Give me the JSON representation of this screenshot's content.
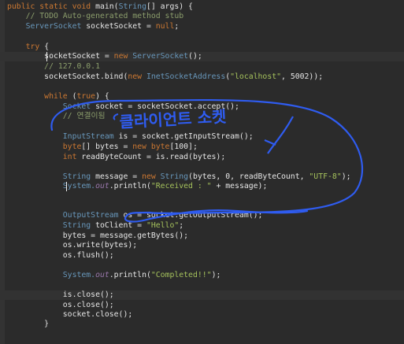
{
  "editor": {
    "lines": [
      {
        "t": 3,
        "parts": [
          {
            "s": "public static void ",
            "c": "kw"
          },
          {
            "s": "main(",
            "c": ""
          },
          {
            "s": "String",
            "c": "ty"
          },
          {
            "s": "[] args) {",
            "c": ""
          }
        ]
      },
      {
        "t": 15,
        "parts": [
          {
            "s": "    // TODO Auto-generated method stub",
            "c": "cm"
          }
        ]
      },
      {
        "t": 28,
        "parts": [
          {
            "s": "    ServerSocket",
            "c": "ty"
          },
          {
            "s": " socketSocket = ",
            "c": ""
          },
          {
            "s": "null",
            "c": "kw"
          },
          {
            "s": ";",
            "c": ""
          }
        ]
      },
      {
        "t": 54,
        "parts": [
          {
            "s": "    try",
            "c": "kw"
          },
          {
            "s": " {",
            "c": ""
          }
        ]
      },
      {
        "t": 66,
        "parts": [
          {
            "s": "        socketSocket = ",
            "c": ""
          },
          {
            "s": "new ",
            "c": "kw"
          },
          {
            "s": "ServerSocket",
            "c": "ty"
          },
          {
            "s": "();",
            "c": ""
          }
        ]
      },
      {
        "t": 79,
        "parts": [
          {
            "s": "        // 127.0.0.1",
            "c": "cm"
          }
        ]
      },
      {
        "t": 92,
        "parts": [
          {
            "s": "        socketSocket.bind(",
            "c": ""
          },
          {
            "s": "new ",
            "c": "kw"
          },
          {
            "s": "InetSocketAddress",
            "c": "ty"
          },
          {
            "s": "(",
            "c": ""
          },
          {
            "s": "\"localhost\"",
            "c": "str"
          },
          {
            "s": ", 5002));",
            "c": ""
          }
        ]
      },
      {
        "t": 117,
        "parts": [
          {
            "s": "        while",
            "c": "kw"
          },
          {
            "s": " (",
            "c": ""
          },
          {
            "s": "true",
            "c": "kw"
          },
          {
            "s": ") {",
            "c": ""
          }
        ]
      },
      {
        "t": 130,
        "parts": [
          {
            "s": "            Socket",
            "c": "ty"
          },
          {
            "s": " socket = socketSocket.accept();",
            "c": ""
          }
        ]
      },
      {
        "t": 142,
        "parts": [
          {
            "s": "            // 연결이됨",
            "c": "cm"
          }
        ]
      },
      {
        "t": 168,
        "parts": [
          {
            "s": "            InputStream",
            "c": "ty"
          },
          {
            "s": " is = socket.getInputStream();",
            "c": ""
          }
        ]
      },
      {
        "t": 181,
        "parts": [
          {
            "s": "            byte",
            "c": "kw"
          },
          {
            "s": "[] bytes = ",
            "c": ""
          },
          {
            "s": "new ",
            "c": "kw"
          },
          {
            "s": "byte",
            "c": "kw"
          },
          {
            "s": "[100];",
            "c": ""
          }
        ]
      },
      {
        "t": 194,
        "parts": [
          {
            "s": "            int",
            "c": "kw"
          },
          {
            "s": " readByteCount = is.read(bytes);",
            "c": ""
          }
        ]
      },
      {
        "t": 219,
        "parts": [
          {
            "s": "            String",
            "c": "ty"
          },
          {
            "s": " message = ",
            "c": ""
          },
          {
            "s": "new ",
            "c": "kw"
          },
          {
            "s": "String",
            "c": "ty"
          },
          {
            "s": "(bytes, 0, readByteCount, ",
            "c": ""
          },
          {
            "s": "\"UTF-8\"",
            "c": "str"
          },
          {
            "s": ");",
            "c": ""
          }
        ]
      },
      {
        "t": 231,
        "parts": [
          {
            "s": "            System.",
            "c": "ty"
          },
          {
            "s": "out",
            "c": "fld"
          },
          {
            "s": ".println(",
            "c": ""
          },
          {
            "s": "\"Received : \"",
            "c": "str"
          },
          {
            "s": " + message);",
            "c": ""
          }
        ]
      },
      {
        "t": 268,
        "parts": [
          {
            "s": "            OutputStream",
            "c": "ty"
          },
          {
            "s": " os = socket.getOutputStream();",
            "c": ""
          }
        ]
      },
      {
        "t": 281,
        "parts": [
          {
            "s": "            String",
            "c": "ty"
          },
          {
            "s": " toClient = ",
            "c": ""
          },
          {
            "s": "\"Hello\"",
            "c": "str"
          },
          {
            "s": ";",
            "c": ""
          }
        ]
      },
      {
        "t": 294,
        "parts": [
          {
            "s": "            bytes = message.getBytes();",
            "c": ""
          }
        ]
      },
      {
        "t": 306,
        "parts": [
          {
            "s": "            os.write(bytes);",
            "c": ""
          }
        ]
      },
      {
        "t": 319,
        "parts": [
          {
            "s": "            os.flush();",
            "c": ""
          }
        ]
      },
      {
        "t": 344,
        "parts": [
          {
            "s": "            System.",
            "c": "ty"
          },
          {
            "s": "out",
            "c": "fld"
          },
          {
            "s": ".println(",
            "c": ""
          },
          {
            "s": "\"Completed!!\"",
            "c": "str"
          },
          {
            "s": ");",
            "c": ""
          }
        ]
      },
      {
        "t": 369,
        "parts": [
          {
            "s": "            is.close();",
            "c": ""
          }
        ]
      },
      {
        "t": 382,
        "parts": [
          {
            "s": "            os.close();",
            "c": ""
          }
        ]
      },
      {
        "t": 394,
        "parts": [
          {
            "s": "            socket.close();",
            "c": ""
          }
        ]
      },
      {
        "t": 406,
        "parts": [
          {
            "s": "        }",
            "c": ""
          }
        ]
      }
    ]
  },
  "annotation": {
    "text": "클라이언트 소켓",
    "color": "#2f5cf0"
  }
}
